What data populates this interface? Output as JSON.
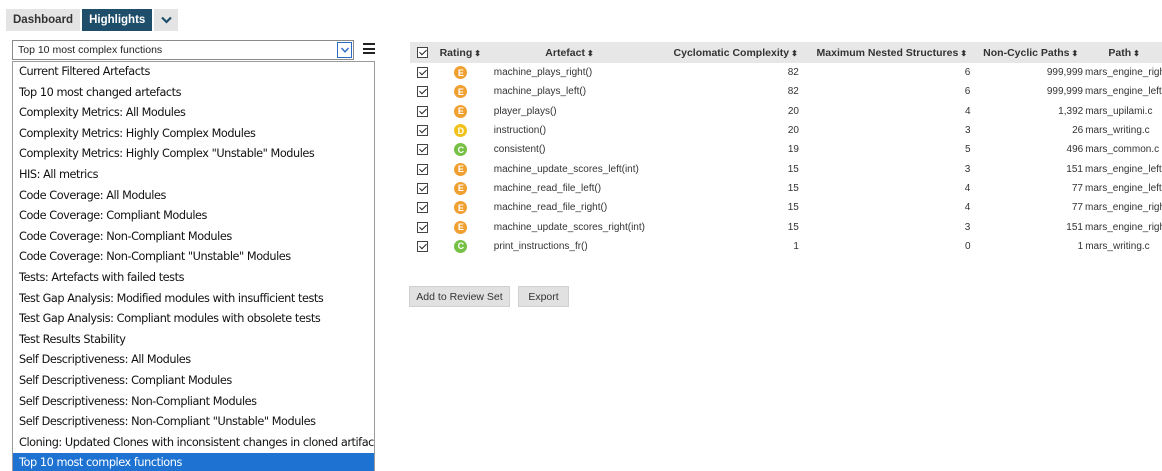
{
  "tabs": [
    {
      "label": "Dashboard"
    },
    {
      "label": "Highlights"
    }
  ],
  "filter": {
    "selected": "Top 10 most complex functions",
    "options": [
      "Current Filtered Artefacts",
      "Top 10 most changed artefacts",
      "Complexity Metrics: All Modules",
      "Complexity Metrics: Highly Complex Modules",
      "Complexity Metrics: Highly Complex \"Unstable\" Modules",
      "HIS: All metrics",
      "Code Coverage: All Modules",
      "Code Coverage: Compliant Modules",
      "Code Coverage: Non-Compliant Modules",
      "Code Coverage: Non-Compliant \"Unstable\" Modules",
      "Tests: Artefacts with failed tests",
      "Test Gap Analysis: Modified modules with insufficient tests",
      "Test Gap Analysis: Compliant modules with obsolete tests",
      "Test Results Stability",
      "Self Descriptiveness: All Modules",
      "Self Descriptiveness: Compliant Modules",
      "Self Descriptiveness: Non-Compliant Modules",
      "Self Descriptiveness: Non-Compliant \"Unstable\" Modules",
      "Cloning: Updated Clones with inconsistent changes in cloned artifacts",
      "Top 10 most complex functions"
    ]
  },
  "table": {
    "headers": {
      "rating": "Rating",
      "artefact": "Artefact",
      "cc": "Cyclomatic Complexity",
      "mns": "Maximum Nested Structures",
      "ncp": "Non-Cyclic Paths",
      "path": "Path"
    },
    "sort_glyph": "⬍",
    "rating_colors": {
      "E": "#f0a030",
      "D": "#f2c21c",
      "C": "#76c045"
    },
    "rows": [
      {
        "rating": "E",
        "artefact": "machine_plays_right()",
        "cc": "82",
        "mns": "6",
        "ncp": "999,999",
        "path": "mars_engine_right.c"
      },
      {
        "rating": "E",
        "artefact": "machine_plays_left()",
        "cc": "82",
        "mns": "6",
        "ncp": "999,999",
        "path": "mars_engine_left.c"
      },
      {
        "rating": "E",
        "artefact": "player_plays()",
        "cc": "20",
        "mns": "4",
        "ncp": "1,392",
        "path": "mars_upilami.c"
      },
      {
        "rating": "D",
        "artefact": "instruction()",
        "cc": "20",
        "mns": "3",
        "ncp": "26",
        "path": "mars_writing.c"
      },
      {
        "rating": "C",
        "artefact": "consistent()",
        "cc": "19",
        "mns": "5",
        "ncp": "496",
        "path": "mars_common.c"
      },
      {
        "rating": "E",
        "artefact": "machine_update_scores_left(int)",
        "cc": "15",
        "mns": "3",
        "ncp": "151",
        "path": "mars_engine_left.c"
      },
      {
        "rating": "E",
        "artefact": "machine_read_file_left()",
        "cc": "15",
        "mns": "4",
        "ncp": "77",
        "path": "mars_engine_left.c"
      },
      {
        "rating": "E",
        "artefact": "machine_read_file_right()",
        "cc": "15",
        "mns": "4",
        "ncp": "77",
        "path": "mars_engine_right.c"
      },
      {
        "rating": "E",
        "artefact": "machine_update_scores_right(int)",
        "cc": "15",
        "mns": "3",
        "ncp": "151",
        "path": "mars_engine_right.c"
      },
      {
        "rating": "C",
        "artefact": "print_instructions_fr()",
        "cc": "1",
        "mns": "0",
        "ncp": "1",
        "path": "mars_writing.c"
      }
    ]
  },
  "buttons": {
    "add_to_review": "Add to Review Set",
    "export": "Export"
  }
}
